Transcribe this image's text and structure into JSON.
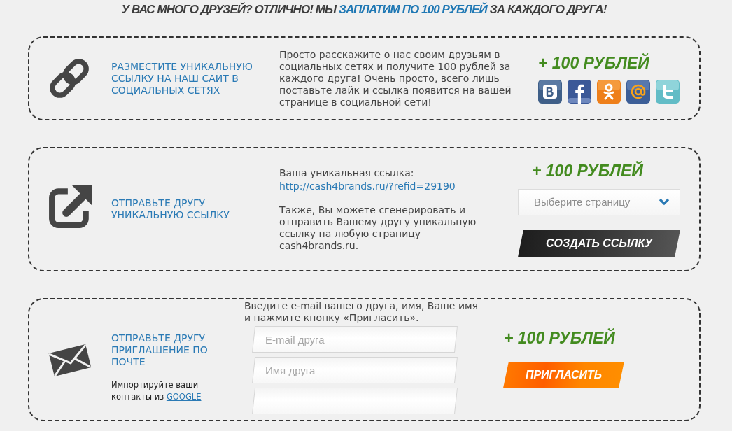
{
  "heading": {
    "text_before": "У ВАС МНОГО ДРУЗЕЙ? ОТЛИЧНО! МЫ",
    "highlighted": "ЗАПЛАТИМ ПО 100 РУБЛЕЙ",
    "text_after": "ЗА КАЖДОГО ДРУГА!"
  },
  "cards": [
    {
      "kind": "social",
      "title": "РАЗМЕСТИТЕ УНИКАЛЬНУЮ ССЫЛКУ НА НАШ САЙТ В СОЦИАЛЬНЫХ СЕТЯХ",
      "description": "Просто расскажите о нас своим друзьям в социальных сетях и получите 100 рублей за каждого друга! Очень просто, всего лишь поставьте лайк и ссылка появится на вашей странице в социальной сети!",
      "reward": "+ 100 РУБЛЕЙ"
    },
    {
      "kind": "link",
      "title": "ОТПРАВЬТЕ ДРУГУ УНИКАЛЬНУЮ ССЫЛКУ",
      "link_label": "Ваша уникальная ссылка:",
      "link": "http://cash4brands.ru/?refid=29190",
      "description": "Также, Вы можете сгенерировать и отправить Вашему другу уникальную ссылку на любую страницу cash4brands.ru.",
      "reward": "+ 100 РУБЛЕЙ",
      "select": {
        "placeholder": "Выберите страницу"
      },
      "button": "СОЗДАТЬ ССЫЛКУ"
    },
    {
      "kind": "email",
      "title": "ОТПРАВЬТЕ ДРУГУ ПРИГЛАШЕНИЕ ПО ПОЧТЕ",
      "import_note": {
        "text": "Импортируйте ваши контакты из",
        "link": "GOOGLE"
      },
      "instructions": "Введите e-mail вашего друга, имя, Ваше имя и нажмите кнопку «Пригласить».",
      "fields": [
        {
          "kind": "hint",
          "placeholder": "E-mail друга"
        },
        {
          "kind": "hint",
          "placeholder": "Имя друга"
        },
        {
          "kind": "blank"
        }
      ],
      "reward": "+ 100 РУБЛЕЙ",
      "button": "ПРИГЛАСИТЬ"
    }
  ]
}
